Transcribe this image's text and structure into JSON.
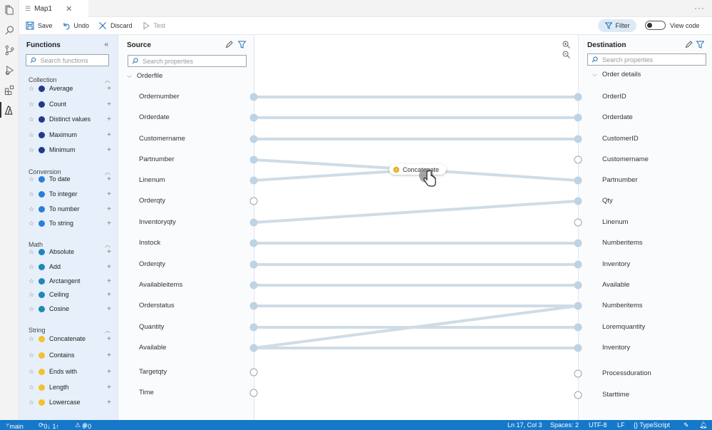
{
  "activity_bar": {
    "icons": [
      "files-icon",
      "search-icon",
      "source-control-icon",
      "run-debug-icon",
      "extensions-icon",
      "azure-icon"
    ]
  },
  "tab": {
    "label": "Map1"
  },
  "toolbar": {
    "save": "Save",
    "undo": "Undo",
    "discard": "Discard",
    "test": "Test",
    "filter": "Filter",
    "view_code": "View code"
  },
  "functions": {
    "title": "Functions",
    "search_placeholder": "Search functions",
    "categories": [
      {
        "name": "Collection",
        "items": [
          {
            "label": "Average",
            "color": "#1f3a8a"
          },
          {
            "label": "Count",
            "color": "#1f3a8a"
          },
          {
            "label": "Distinct values",
            "color": "#1f3a8a"
          },
          {
            "label": "Maximum",
            "color": "#1f3a8a"
          },
          {
            "label": "Minimum",
            "color": "#1f3a8a"
          }
        ]
      },
      {
        "name": "Conversion",
        "items": [
          {
            "label": "To date",
            "color": "#2a7fd4"
          },
          {
            "label": "To integer",
            "color": "#2a7fd4"
          },
          {
            "label": "To number",
            "color": "#2a7fd4"
          },
          {
            "label": "To string",
            "color": "#2a7fd4"
          }
        ]
      },
      {
        "name": "Math",
        "items": [
          {
            "label": "Absolute",
            "color": "#1e88b8"
          },
          {
            "label": "Add",
            "color": "#1e88b8"
          },
          {
            "label": "Arctangent",
            "color": "#1e88b8"
          },
          {
            "label": "Ceiling",
            "color": "#1e88b8"
          },
          {
            "label": "Cosine",
            "color": "#1e88b8"
          }
        ]
      },
      {
        "name": "String",
        "items": [
          {
            "label": "Concatenate",
            "color": "#f2c12e"
          },
          {
            "label": "Contains",
            "color": "#f2c12e"
          },
          {
            "label": "Ends with",
            "color": "#f2c12e"
          },
          {
            "label": "Length",
            "color": "#f2c12e"
          },
          {
            "label": "Lowercase",
            "color": "#f2c12e"
          }
        ]
      }
    ]
  },
  "source": {
    "title": "Source",
    "search_placeholder": "Search properties",
    "root": "Orderfile",
    "fields": [
      "Ordernumber",
      "Orderdate",
      "Customername",
      "Partnumber",
      "Linenum",
      "Orderqty",
      "Inventoryqty",
      "Instock",
      "Orderqty",
      "Availableitems",
      "Orderstatus",
      "Quantity",
      "Available",
      "Targetqty",
      "Time"
    ]
  },
  "destination": {
    "title": "Destination",
    "search_placeholder": "Search properties",
    "root": "Order details",
    "fields": [
      "OrderID",
      "Orderdate",
      "CustomerID",
      "Customername",
      "Partnumber",
      "Qty",
      "Linenum",
      "Numberitems",
      "Inventory",
      "Available",
      "Numberitems",
      "Loremquantity",
      "Inventory",
      "Processduration",
      "Starttime"
    ]
  },
  "canvas": {
    "function_node": "Concatenate",
    "function_color": "#f2c12e"
  },
  "statusbar": {
    "branch": "main",
    "sync": "0↓ 1↑",
    "problems": "0",
    "warnings": "0",
    "position": "Ln 17, Col 3",
    "spaces": "Spaces: 2",
    "encoding": "UTF-8",
    "eol": "LF",
    "language": "{} TypeScript"
  }
}
